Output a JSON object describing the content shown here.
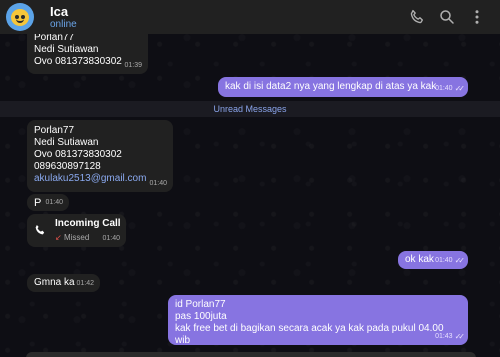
{
  "header": {
    "name": "Ica",
    "status": "online"
  },
  "unread_label": "Unread Messages",
  "messages": [
    {
      "lines": [
        "Porlan77",
        "Nedi Sutiawan",
        "Ovo 081373830302"
      ],
      "time": "01:39"
    },
    {
      "text": "kak di isi data2 nya yang lengkap di atas ya kak",
      "time": "01:40"
    },
    {
      "lines": [
        "Porlan77",
        "Nedi Sutiawan",
        "Ovo 081373830302",
        "089630897128",
        "akulaku2513@gmail.com"
      ],
      "time": "01:40"
    },
    {
      "text": "P",
      "time": "01:40"
    },
    {
      "call_title": "Incoming Call",
      "call_sub": "Missed",
      "time": "01:40"
    },
    {
      "text": "ok kak",
      "time": "01:40"
    },
    {
      "text": "Gmna ka",
      "time": "01:42"
    },
    {
      "lines": [
        "id Porlan77",
        "pas 100juta",
        "kak free bet di bagikan secara acak ya kak pada pukul 04.00 wib"
      ],
      "time": "01:43"
    }
  ]
}
